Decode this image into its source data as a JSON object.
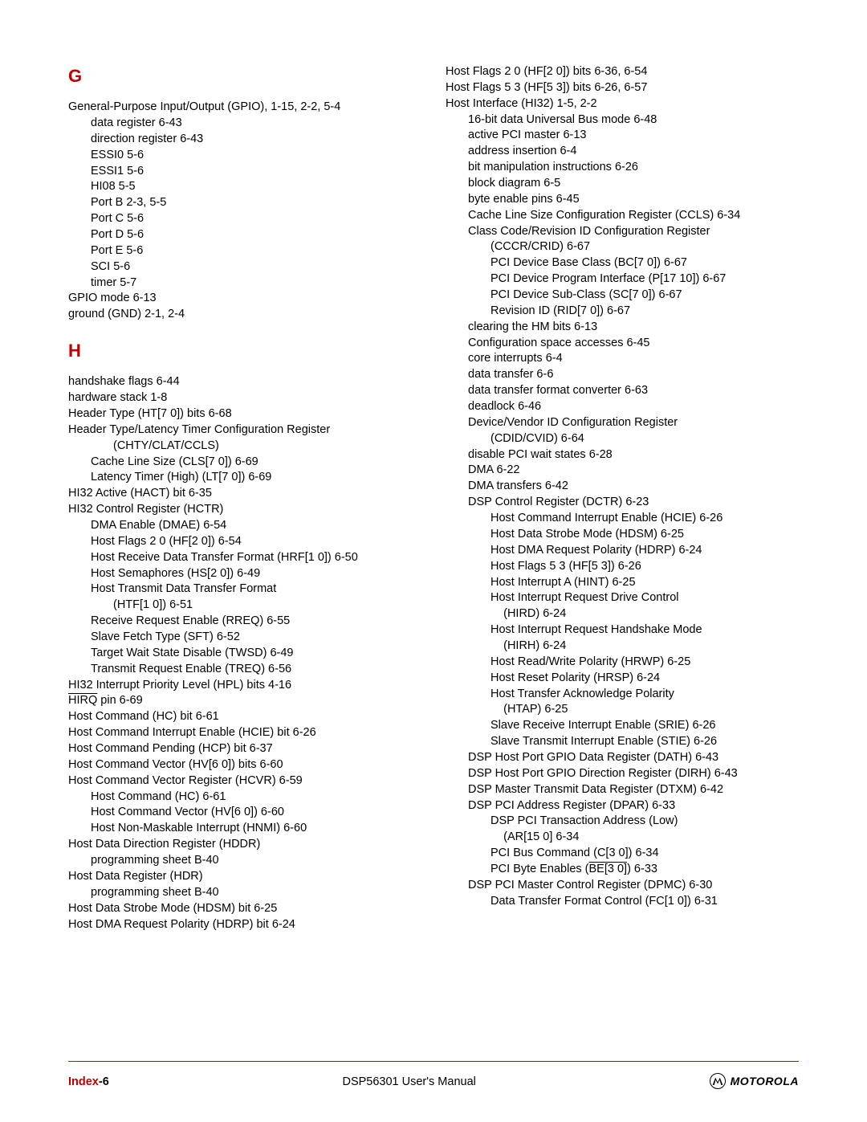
{
  "footer": {
    "index_label": "Index",
    "page_num": "-6",
    "center": "DSP56301 User's Manual",
    "brand": "MOTOROLA",
    "brand_icon_char": "Ⓐ"
  },
  "colA": {
    "letter_G": "G",
    "g": [
      {
        "cls": "entry",
        "t": "General-Purpose Input/Output (GPIO), 1-15, 2-2, 5-4"
      },
      {
        "cls": "entry i1",
        "t": "data register 6-43"
      },
      {
        "cls": "entry i1",
        "t": "direction register 6-43"
      },
      {
        "cls": "entry i1",
        "t": "ESSI0 5-6"
      },
      {
        "cls": "entry i1",
        "t": "ESSI1 5-6"
      },
      {
        "cls": "entry i1",
        "t": "HI08 5-5"
      },
      {
        "cls": "entry i1",
        "t": "Port B 2-3, 5-5"
      },
      {
        "cls": "entry i1",
        "t": "Port C 5-6"
      },
      {
        "cls": "entry i1",
        "t": "Port D 5-6"
      },
      {
        "cls": "entry i1",
        "t": "Port E 5-6"
      },
      {
        "cls": "entry i1",
        "t": "SCI 5-6"
      },
      {
        "cls": "entry i1",
        "t": "timer 5-7"
      },
      {
        "cls": "entry",
        "t": "GPIO mode 6-13"
      },
      {
        "cls": "entry",
        "t": "ground (GND) 2-1, 2-4"
      }
    ],
    "letter_H": "H",
    "h": [
      {
        "cls": "entry",
        "t": "handshake flags 6-44"
      },
      {
        "cls": "entry",
        "t": "hardware stack 1-8"
      },
      {
        "cls": "entry",
        "t": "Header Type (HT[7 0]) bits 6-68"
      },
      {
        "cls": "entry",
        "t": "Header Type/Latency Timer Configuration Register"
      },
      {
        "cls": "entry i2",
        "t": "(CHTY/CLAT/CCLS)"
      },
      {
        "cls": "entry i1",
        "t": "Cache Line Size (CLS[7 0]) 6-69"
      },
      {
        "cls": "entry i1",
        "t": "Latency Timer (High) (LT[7 0]) 6-69"
      },
      {
        "cls": "entry",
        "t": "HI32 Active (HACT) bit 6-35"
      },
      {
        "cls": "entry",
        "t": "HI32 Control Register (HCTR)"
      },
      {
        "cls": "entry i1",
        "t": "DMA Enable (DMAE) 6-54"
      },
      {
        "cls": "entry i1",
        "t": "Host Flags 2 0 (HF[2 0]) 6-54"
      },
      {
        "cls": "entry i1",
        "t": "Host Receive Data Transfer Format (HRF[1 0]) 6-50"
      },
      {
        "cls": "entry i1",
        "t": "Host Semaphores (HS[2 0]) 6-49"
      },
      {
        "cls": "entry i1",
        "t": "Host Transmit Data Transfer Format"
      },
      {
        "cls": "entry i2",
        "t": "(HTF[1 0]) 6-51"
      },
      {
        "cls": "entry i1",
        "t": "Receive Request Enable (RREQ) 6-55"
      },
      {
        "cls": "entry i1",
        "t": "Slave Fetch Type (SFT) 6-52"
      },
      {
        "cls": "entry i1",
        "t": "Target Wait State Disable (TWSD) 6-49"
      },
      {
        "cls": "entry i1",
        "t": "Transmit Request Enable (TREQ) 6-56"
      },
      {
        "cls": "entry",
        "t": "HI32 Interrupt Priority Level (HPL) bits 4-16"
      }
    ],
    "hirq_pre": "",
    "hirq_over": "HIRQ",
    "hirq_post": " pin 6-69",
    "h2": [
      {
        "cls": "entry",
        "t": "Host Command (HC) bit 6-61"
      },
      {
        "cls": "entry",
        "t": "Host Command Interrupt Enable (HCIE) bit 6-26"
      },
      {
        "cls": "entry",
        "t": "Host Command Pending (HCP) bit 6-37"
      },
      {
        "cls": "entry",
        "t": "Host Command Vector (HV[6 0]) bits 6-60"
      },
      {
        "cls": "entry",
        "t": "Host Command Vector Register (HCVR) 6-59"
      },
      {
        "cls": "entry i1",
        "t": "Host Command (HC) 6-61"
      },
      {
        "cls": "entry i1",
        "t": "Host Command Vector (HV[6 0]) 6-60"
      },
      {
        "cls": "entry i1",
        "t": "Host Non-Maskable Interrupt (HNMI) 6-60"
      },
      {
        "cls": "entry",
        "t": "Host Data Direction Register (HDDR)"
      },
      {
        "cls": "entry i1",
        "t": "programming sheet B-40"
      },
      {
        "cls": "entry",
        "t": "Host Data Register (HDR)"
      },
      {
        "cls": "entry i1",
        "t": "programming sheet B-40"
      },
      {
        "cls": "entry",
        "t": "Host Data Strobe Mode (HDSM) bit 6-25"
      },
      {
        "cls": "entry",
        "t": "Host DMA Request Polarity (HDRP) bit 6-24"
      }
    ]
  },
  "colB": {
    "top": [
      {
        "cls": "entry",
        "t": "Host Flags 2 0 (HF[2 0]) bits 6-36, 6-54"
      },
      {
        "cls": "entry",
        "t": "Host Flags 5 3 (HF[5 3]) bits 6-26, 6-57"
      },
      {
        "cls": "entry",
        "t": "Host Interface (HI32) 1-5, 2-2"
      },
      {
        "cls": "entry i1",
        "t": "16-bit data Universal Bus mode 6-48"
      },
      {
        "cls": "entry i1",
        "t": "active PCI master 6-13"
      },
      {
        "cls": "entry i1",
        "t": "address insertion 6-4"
      },
      {
        "cls": "entry i1",
        "t": "bit manipulation instructions 6-26"
      },
      {
        "cls": "entry i1",
        "t": "block diagram 6-5"
      },
      {
        "cls": "entry i1",
        "t": "byte enable pins 6-45"
      },
      {
        "cls": "entry i1",
        "t": "Cache Line Size Configuration Register (CCLS) 6-34"
      },
      {
        "cls": "entry i1",
        "t": "Class Code/Revision ID Configuration Register"
      },
      {
        "cls": "entry i2",
        "t": "(CCCR/CRID) 6-67"
      },
      {
        "cls": "entry i2",
        "t": "PCI Device Base Class (BC[7 0]) 6-67"
      },
      {
        "cls": "entry i2",
        "t": "PCI Device Program Interface (P[17 10]) 6-67"
      },
      {
        "cls": "entry i2",
        "t": "PCI Device Sub-Class (SC[7 0]) 6-67"
      },
      {
        "cls": "entry i2",
        "t": "Revision ID (RID[7 0]) 6-67"
      },
      {
        "cls": "entry i1",
        "t": "clearing the HM bits 6-13"
      },
      {
        "cls": "entry i1",
        "t": "Configuration space accesses 6-45"
      },
      {
        "cls": "entry i1",
        "t": "core interrupts 6-4"
      },
      {
        "cls": "entry i1",
        "t": "data transfer 6-6"
      },
      {
        "cls": "entry i1",
        "t": "data transfer format converter 6-63"
      },
      {
        "cls": "entry i1",
        "t": "deadlock 6-46"
      },
      {
        "cls": "entry i1",
        "t": "Device/Vendor ID Configuration Register"
      },
      {
        "cls": "entry i2",
        "t": "(CDID/CVID) 6-64"
      },
      {
        "cls": "entry i1",
        "t": "disable PCI wait states 6-28"
      },
      {
        "cls": "entry i1",
        "t": "DMA 6-22"
      },
      {
        "cls": "entry i1",
        "t": "DMA transfers 6-42"
      },
      {
        "cls": "entry i1",
        "t": "DSP Control Register (DCTR) 6-23"
      },
      {
        "cls": "entry i2",
        "t": "Host Command Interrupt Enable (HCIE) 6-26"
      },
      {
        "cls": "entry i2",
        "t": "Host Data Strobe Mode (HDSM) 6-25"
      },
      {
        "cls": "entry i2",
        "t": "Host DMA Request Polarity (HDRP) 6-24"
      },
      {
        "cls": "entry i2",
        "t": "Host Flags 5 3 (HF[5 3]) 6-26"
      },
      {
        "cls": "entry i2",
        "t": "Host Interrupt A (HINT) 6-25"
      },
      {
        "cls": "entry i2",
        "t": "Host Interrupt Request Drive Control"
      },
      {
        "cls": "entry i2",
        "t": "&nbsp;&nbsp;&nbsp;&nbsp;(HIRD) 6-24"
      },
      {
        "cls": "entry i2",
        "t": "Host Interrupt Request Handshake Mode"
      },
      {
        "cls": "entry i2",
        "t": "&nbsp;&nbsp;&nbsp;&nbsp;(HIRH) 6-24"
      },
      {
        "cls": "entry i2",
        "t": "Host Read/Write Polarity (HRWP) 6-25"
      },
      {
        "cls": "entry i2",
        "t": "Host Reset Polarity (HRSP) 6-24"
      },
      {
        "cls": "entry i2",
        "t": "Host Transfer Acknowledge Polarity"
      },
      {
        "cls": "entry i2",
        "t": "&nbsp;&nbsp;&nbsp;&nbsp;(HTAP) 6-25"
      },
      {
        "cls": "entry i2",
        "t": "Slave Receive Interrupt Enable (SRIE) 6-26"
      },
      {
        "cls": "entry i2",
        "t": "Slave Transmit Interrupt Enable (STIE) 6-26"
      },
      {
        "cls": "entry i1",
        "t": "DSP Host Port GPIO Data Register (DATH) 6-43"
      },
      {
        "cls": "entry i1",
        "t": "DSP Host Port GPIO Direction Register (DIRH) 6-43"
      },
      {
        "cls": "entry i1",
        "t": "DSP Master Transmit Data Register (DTXM) 6-42"
      },
      {
        "cls": "entry i1",
        "t": "DSP PCI Address Register (DPAR) 6-33"
      },
      {
        "cls": "entry i2",
        "t": "DSP PCI Transaction Address (Low)"
      },
      {
        "cls": "entry i2",
        "t": "&nbsp;&nbsp;&nbsp;&nbsp;(AR[15 0] 6-34"
      },
      {
        "cls": "entry i2",
        "t": "PCI Bus Command (C[3 0]) 6-34"
      }
    ],
    "be_pre": "PCI Byte Enables (",
    "be_over": "BE[3 0]",
    "be_post": ") 6-33",
    "bottom": [
      {
        "cls": "entry i1",
        "t": "DSP PCI Master Control Register (DPMC) 6-30"
      },
      {
        "cls": "entry i2",
        "t": "Data Transfer Format Control (FC[1 0]) 6-31"
      }
    ]
  }
}
